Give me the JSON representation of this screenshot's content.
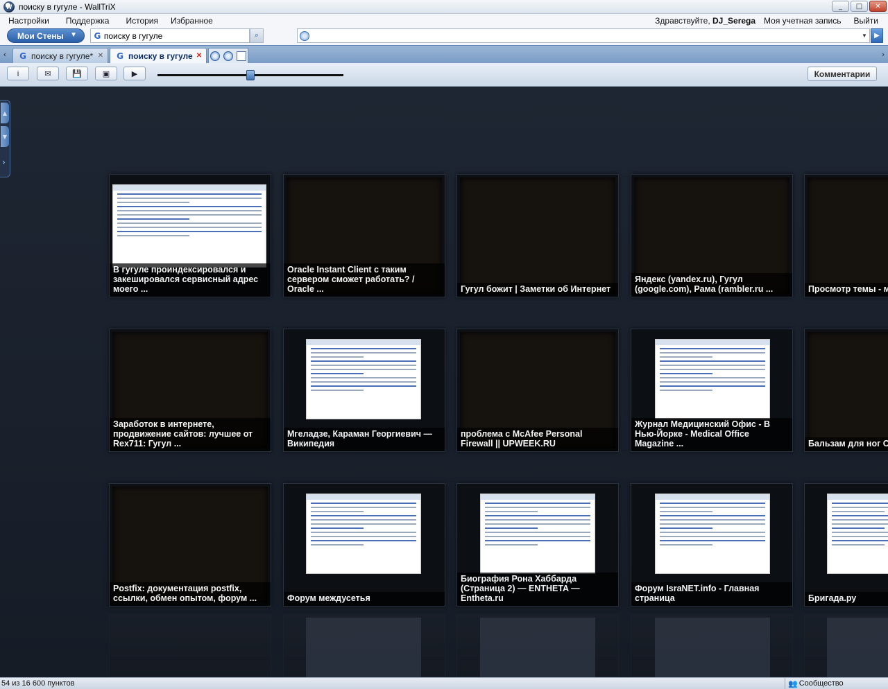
{
  "window": {
    "title": "поиску в гугуле - WallTriX",
    "controls": {
      "minimize": "_",
      "maximize": "□",
      "close": "✕"
    }
  },
  "menu": {
    "items": [
      "Настройки",
      "Поддержка",
      "История",
      "Избранное"
    ],
    "greeting_prefix": "Здравствуйте, ",
    "username": "DJ_Serega",
    "account": "Моя учетная запись",
    "logout": "Выйти"
  },
  "address": {
    "walls_button": "Мои Стены",
    "search_value": "поиску в гугуле",
    "url_value": ""
  },
  "tabs": [
    {
      "label": "поиску в гугуле*",
      "active": false
    },
    {
      "label": "поиску в гугуле",
      "active": true
    }
  ],
  "toolbar": {
    "zoom_fraction": 0.5,
    "comments_label": "Комментарии"
  },
  "tiles": [
    {
      "caption": "В гугуле проиндексировался и закешировался сервисный адрес моего ...",
      "has_screenshot": true
    },
    {
      "caption": "Oracle Instant Client с таким сервером сможет работать? / Oracle ...",
      "has_screenshot": false
    },
    {
      "caption": "Гугул божит | Заметки об Интернет",
      "has_screenshot": false
    },
    {
      "caption": "Яндекс (yandex.ru), Гугул (google.com), Рама (rambler.ru ...",
      "has_screenshot": false
    },
    {
      "caption": "Просмотр темы - модем в лицо? | С",
      "has_screenshot": false
    },
    {
      "caption": "Заработок в интернете, продвижение сайтов: лучшее от Rex711: Гугул ...",
      "has_screenshot": false
    },
    {
      "caption": "Мгеладзе, Караман Георгиевич — Википедия",
      "has_screenshot": true
    },
    {
      "caption": "проблема с McAfee Personal Firewall || UPWEEK.RU",
      "has_screenshot": false
    },
    {
      "caption": "Журнал Медицинский Офис - В Нью-Йорке - Medical Office Magazine ...",
      "has_screenshot": true
    },
    {
      "caption": "Бальзам для ног С Аюрведа Здесь",
      "has_screenshot": false
    },
    {
      "caption": "Postfix: документация postfix, ссылки, обмен опытом, форум ...",
      "has_screenshot": false
    },
    {
      "caption": "Форум междусетья",
      "has_screenshot": true
    },
    {
      "caption": "Биография Рона Хаббарда (Страница 2) — ENTHETA — Entheta.ru",
      "has_screenshot": true
    },
    {
      "caption": "Форум IsraNET.info - Главная страница",
      "has_screenshot": true
    },
    {
      "caption": "Бригада.ру",
      "has_screenshot": true
    }
  ],
  "status": {
    "count_text": "54 из 16 600 пунктов",
    "community": "Сообщество"
  },
  "colors": {
    "wall_bg": "#1b2230",
    "accent": "#2a5fa6"
  }
}
